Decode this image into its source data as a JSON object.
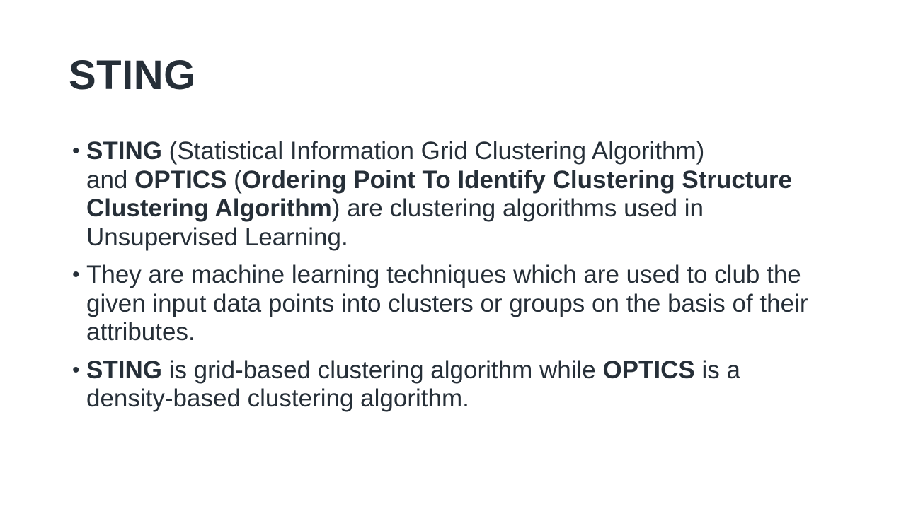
{
  "slide": {
    "title": "STING",
    "bullet_symbol": "•",
    "bullets": [
      {
        "segments": [
          {
            "text": "STING",
            "bold": true
          },
          {
            "text": " (Statistical Information Grid Clustering Algorithm)",
            "bold": false
          },
          {
            "text": " and ",
            "bold": false
          },
          {
            "text": "OPTICS",
            "bold": true
          },
          {
            "text": " (",
            "bold": false
          },
          {
            "text": "Ordering Point To Identify Clustering Structure Clustering Algorithm",
            "bold": true
          },
          {
            "text": ") are clustering algorithms used in Unsupervised Learning.",
            "bold": false
          }
        ]
      },
      {
        "segments": [
          {
            "text": "They are machine learning techniques which are used to club the given input data points into clusters or groups on the basis of their attributes.",
            "bold": false
          }
        ]
      },
      {
        "segments": [
          {
            "text": "STING",
            "bold": true
          },
          {
            "text": " is grid-based clustering algorithm while ",
            "bold": false
          },
          {
            "text": "OPTICS",
            "bold": true
          },
          {
            "text": " is a density-based clustering algorithm.",
            "bold": false
          }
        ]
      }
    ]
  }
}
